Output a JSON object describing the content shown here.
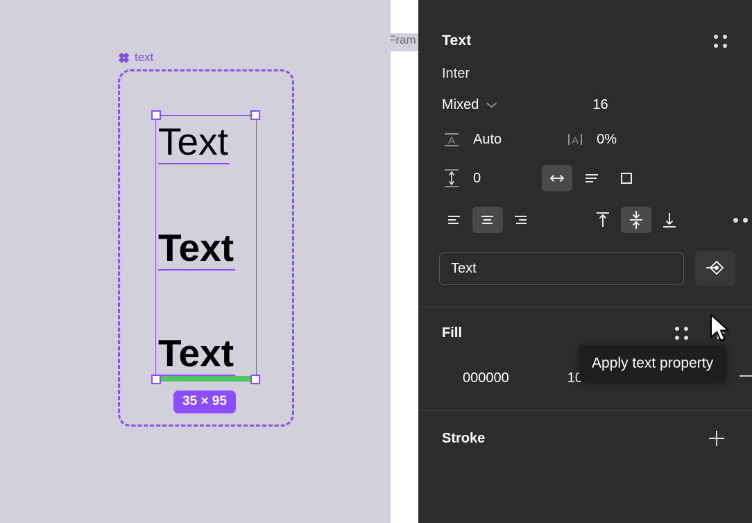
{
  "canvas": {
    "background_color": "#d2d0da",
    "instance": {
      "label": "text",
      "icon": "component-diamond-icon",
      "accent_color": "#8b4dff"
    },
    "text_layers": [
      {
        "content": "Text",
        "weight": "regular"
      },
      {
        "content": "Text",
        "weight": "bold"
      },
      {
        "content": "Text",
        "weight": "bold"
      }
    ],
    "size_badge": "35 × 95",
    "snap_indicator_color": "#4fc563",
    "frame_label": "Fram"
  },
  "panel": {
    "text_section": {
      "title": "Text",
      "styles_icon": "dots-grid-icon",
      "font_family": "Inter",
      "font_style": "Mixed",
      "font_style_chevron": "chevron-down-icon",
      "font_size": "16",
      "line_height_icon": "line-height-icon",
      "line_height": "Auto",
      "letter_spacing_icon": "letter-spacing-icon",
      "letter_spacing": "0%",
      "paragraph_spacing_icon": "paragraph-spacing-icon",
      "paragraph_spacing": "0",
      "resize_modes": [
        {
          "name": "auto-width",
          "icon": "auto-width-icon",
          "active": true
        },
        {
          "name": "auto-height",
          "icon": "auto-height-icon",
          "active": false
        },
        {
          "name": "fixed-size",
          "icon": "fixed-size-icon",
          "active": false
        }
      ],
      "horizontal_align": [
        {
          "name": "align-left",
          "icon": "align-left-icon",
          "active": false
        },
        {
          "name": "align-center",
          "icon": "align-center-icon",
          "active": true
        },
        {
          "name": "align-right",
          "icon": "align-right-icon",
          "active": false
        }
      ],
      "vertical_align": [
        {
          "name": "align-top",
          "icon": "align-top-icon",
          "active": false
        },
        {
          "name": "align-middle",
          "icon": "align-middle-icon",
          "active": true
        },
        {
          "name": "align-bottom",
          "icon": "align-bottom-icon",
          "active": false
        }
      ],
      "more_options_icon": "more-horizontal-icon",
      "property_input_value": "Text",
      "property_input_placeholder": "Text",
      "apply_button_icon": "apply-property-icon"
    },
    "fill_section": {
      "title": "Fill",
      "styles_icon": "dots-grid-icon",
      "add_icon": "plus-icon",
      "color_hex": "000000",
      "opacity": "100%",
      "visibility_icon": "eye-icon",
      "remove_icon": "minus-icon",
      "swatch_color": "#000000"
    },
    "stroke_section": {
      "title": "Stroke",
      "add_icon": "plus-icon"
    },
    "tooltip": "Apply text property",
    "cursor_icon": "mouse-pointer-icon",
    "background_color": "#2c2c2c"
  }
}
